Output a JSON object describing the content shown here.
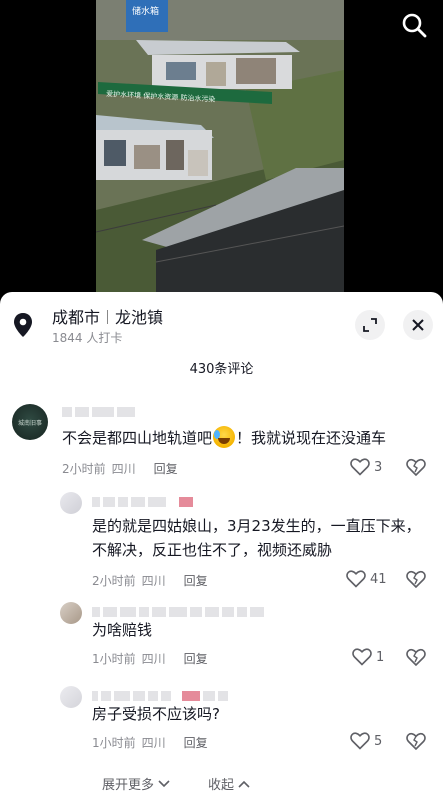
{
  "video": {
    "search_icon": "search-icon",
    "sign_text": "爱护水环境 保护水资源 防治水污染",
    "tag_text": "储水箱"
  },
  "location": {
    "city": "成都市",
    "town": "龙池镇",
    "checkins": "1844 人打卡",
    "pin_icon": "location-pin-icon",
    "expand_icon": "expand-icon",
    "close_icon": "close-icon"
  },
  "comments_count": "430条评论",
  "comments": [
    {
      "avatar_text": "城南旧事",
      "text_before_emoji": "不会是都四山地轨道吧",
      "text_after_emoji": "！我就说现在还没通车",
      "time": "2小时前",
      "region": "四川",
      "reply": "回复",
      "likes": "3"
    },
    {
      "text": "是的就是四姑娘山，3月23发生的，一直压下来，不解决，反正也住不了，视频还威胁",
      "time": "2小时前",
      "region": "四川",
      "reply": "回复",
      "likes": "41"
    },
    {
      "text": "为啥赔钱",
      "time": "1小时前",
      "region": "四川",
      "reply": "回复",
      "likes": "1"
    },
    {
      "text": "房子受损不应该吗?",
      "time": "1小时前",
      "region": "四川",
      "reply": "回复",
      "likes": "5"
    }
  ],
  "footer": {
    "expand_more": "展开更多",
    "collapse": "收起"
  },
  "colors": {
    "text": "#161823",
    "meta": "#8a8b91",
    "sheet_bg": "#ffffff",
    "button_bg": "#f1f1f2"
  }
}
